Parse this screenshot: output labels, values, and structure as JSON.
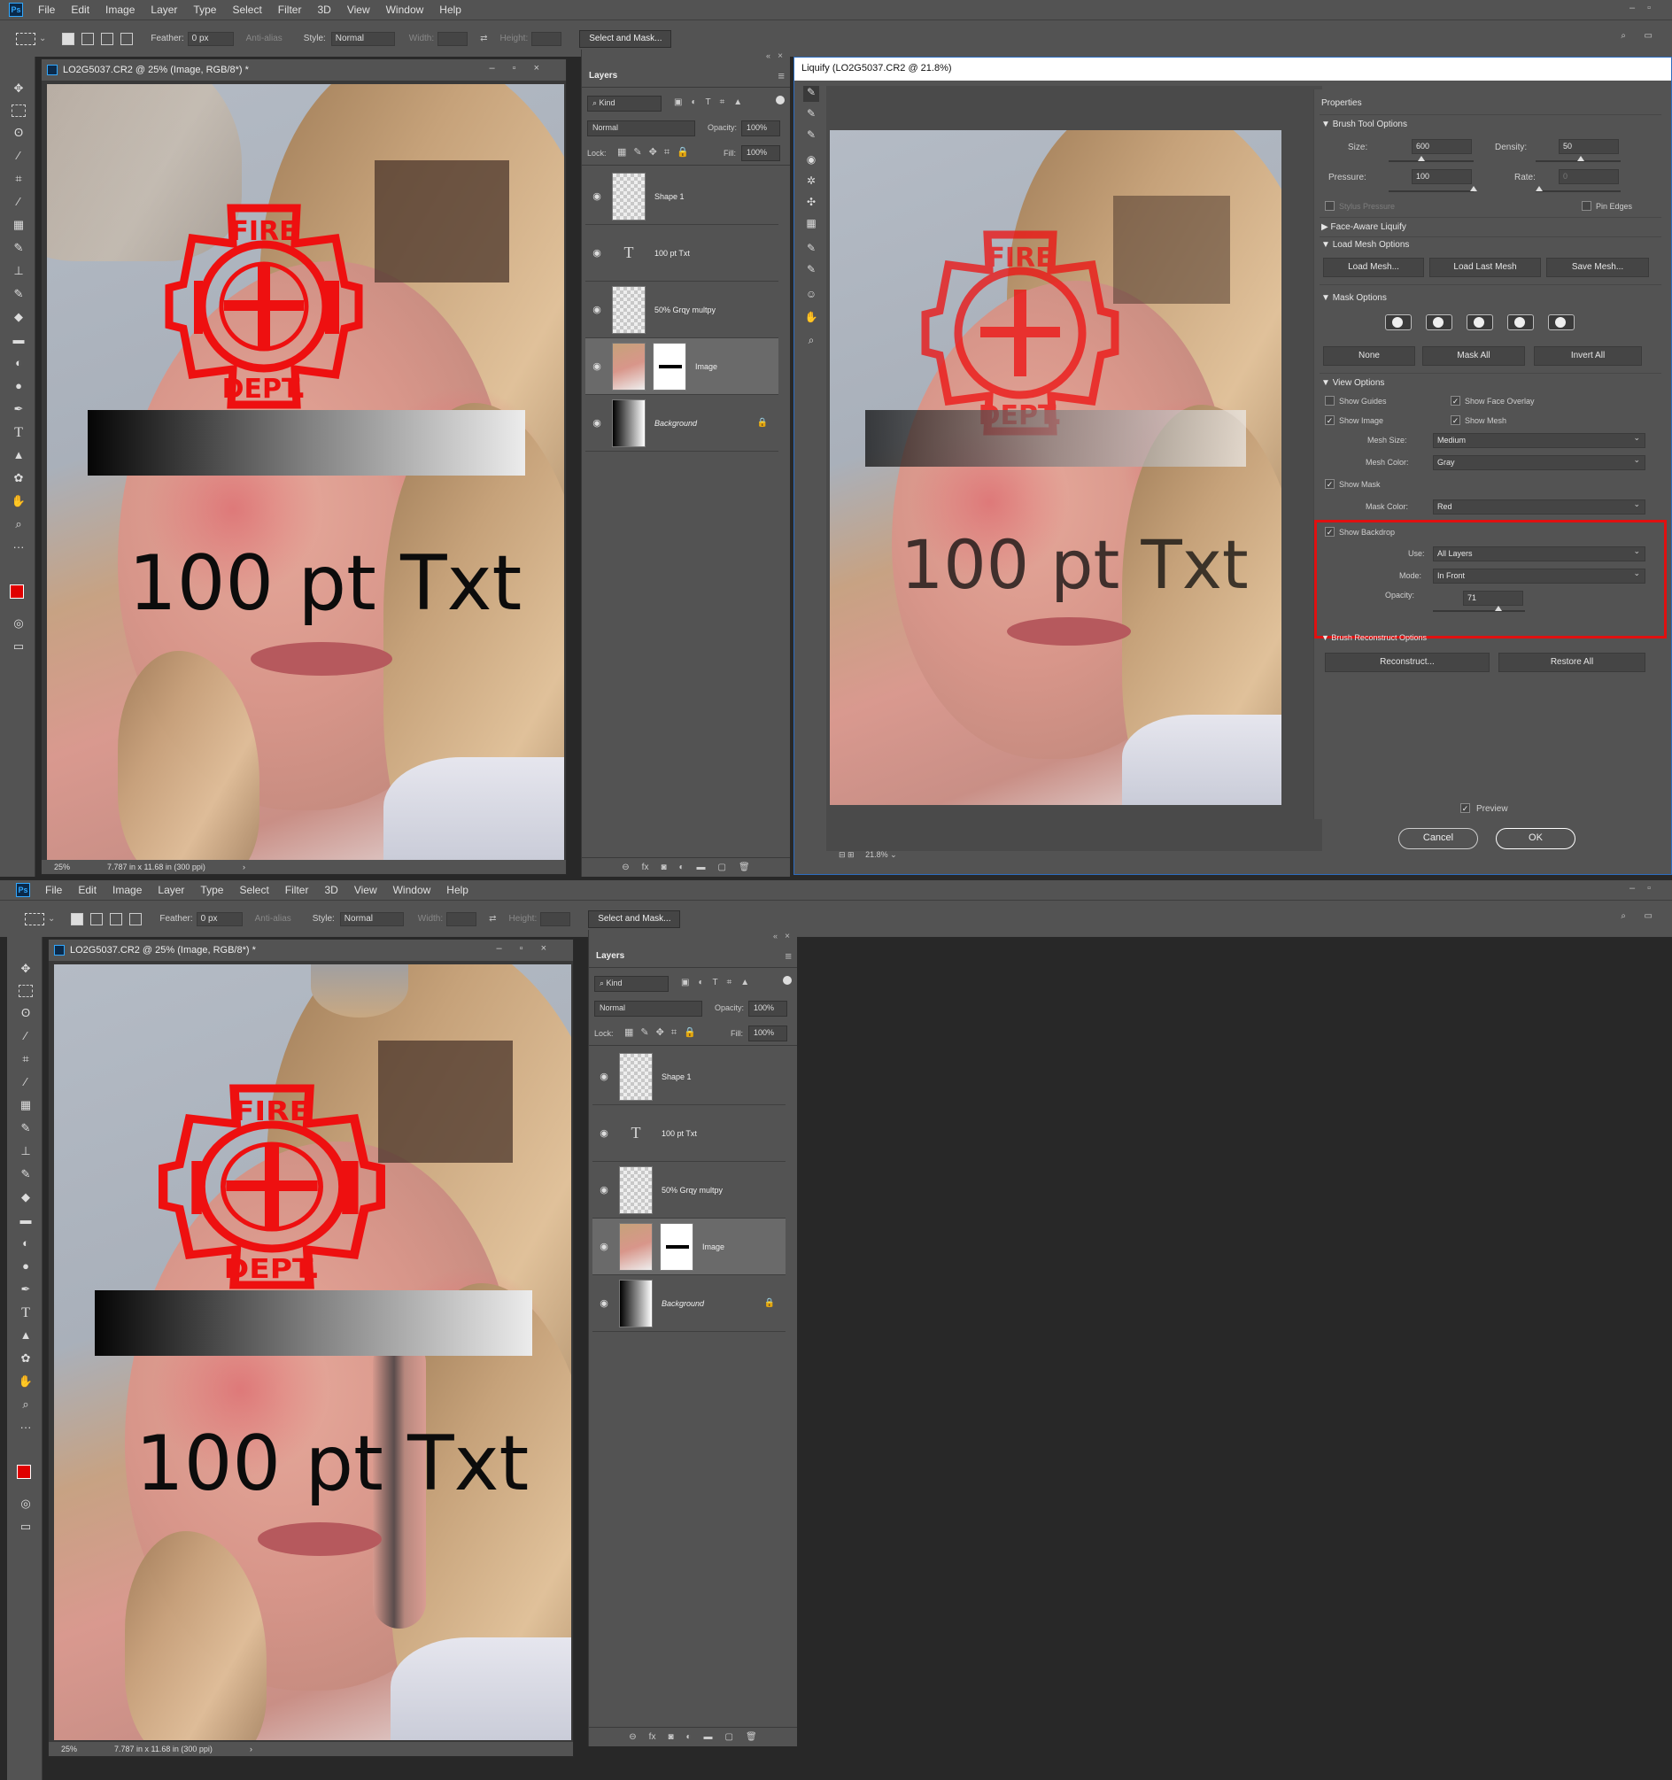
{
  "app": {
    "menus": [
      "File",
      "Edit",
      "Image",
      "Layer",
      "Type",
      "Select",
      "Filter",
      "3D",
      "View",
      "Window",
      "Help"
    ]
  },
  "options": {
    "feather_label": "Feather:",
    "feather_value": "0 px",
    "antialias": "Anti-alias",
    "style_label": "Style:",
    "style_value": "Normal",
    "width_label": "Width:",
    "height_label": "Height:",
    "select_mask": "Select and Mask..."
  },
  "doc": {
    "title": "LO2G5037.CR2 @ 25% (Image, RGB/8*) *",
    "zoom": "25%",
    "dims": "7.787 in x 11.68 in (300 ppi)",
    "arrow": "›"
  },
  "canvas_text": "100 pt Txt",
  "badge": {
    "top": "FIRE",
    "bottom": "DEPT."
  },
  "layers": {
    "tab": "Layers",
    "kind": "Kind",
    "blend": "Normal",
    "opacity_label": "Opacity:",
    "opacity": "100%",
    "lock_label": "Lock:",
    "fill_label": "Fill:",
    "fill": "100%",
    "items": [
      {
        "name": "Shape 1"
      },
      {
        "name": "100 pt Txt"
      },
      {
        "name": "50% Grqy multpy"
      },
      {
        "name": "Image"
      },
      {
        "name": "Background"
      }
    ]
  },
  "liquify": {
    "title": "Liquify (LO2G5037.CR2 @ 21.8%)",
    "zoom": "21.8%",
    "properties": "Properties",
    "brush_tool_options": "Brush Tool Options",
    "size_label": "Size:",
    "size": "600",
    "density_label": "Density:",
    "density": "50",
    "pressure_label": "Pressure:",
    "pressure": "100",
    "rate_label": "Rate:",
    "rate": "0",
    "stylus_pressure": "Stylus Pressure",
    "pin_edges": "Pin Edges",
    "face_aware": "Face-Aware Liquify",
    "load_mesh_options": "Load Mesh Options",
    "load_mesh": "Load Mesh...",
    "load_last_mesh": "Load Last Mesh",
    "save_mesh": "Save Mesh...",
    "mask_options": "Mask Options",
    "none": "None",
    "mask_all": "Mask All",
    "invert_all": "Invert All",
    "view_options": "View Options",
    "show_guides": "Show Guides",
    "show_face_overlay": "Show Face Overlay",
    "show_image": "Show Image",
    "show_mesh": "Show Mesh",
    "mesh_size_label": "Mesh Size:",
    "mesh_size": "Medium",
    "mesh_color_label": "Mesh Color:",
    "mesh_color": "Gray",
    "show_mask": "Show Mask",
    "mask_color_label": "Mask Color:",
    "mask_color": "Red",
    "show_backdrop": "Show Backdrop",
    "use_label": "Use:",
    "use": "All Layers",
    "mode_label": "Mode:",
    "mode": "In Front",
    "opacity_label": "Opacity:",
    "opacity": "71",
    "brush_reconstruct": "Brush Reconstruct Options",
    "reconstruct": "Reconstruct...",
    "restore_all": "Restore All",
    "preview": "Preview",
    "cancel": "Cancel",
    "ok": "OK",
    "highlight_color": "#e01010"
  }
}
